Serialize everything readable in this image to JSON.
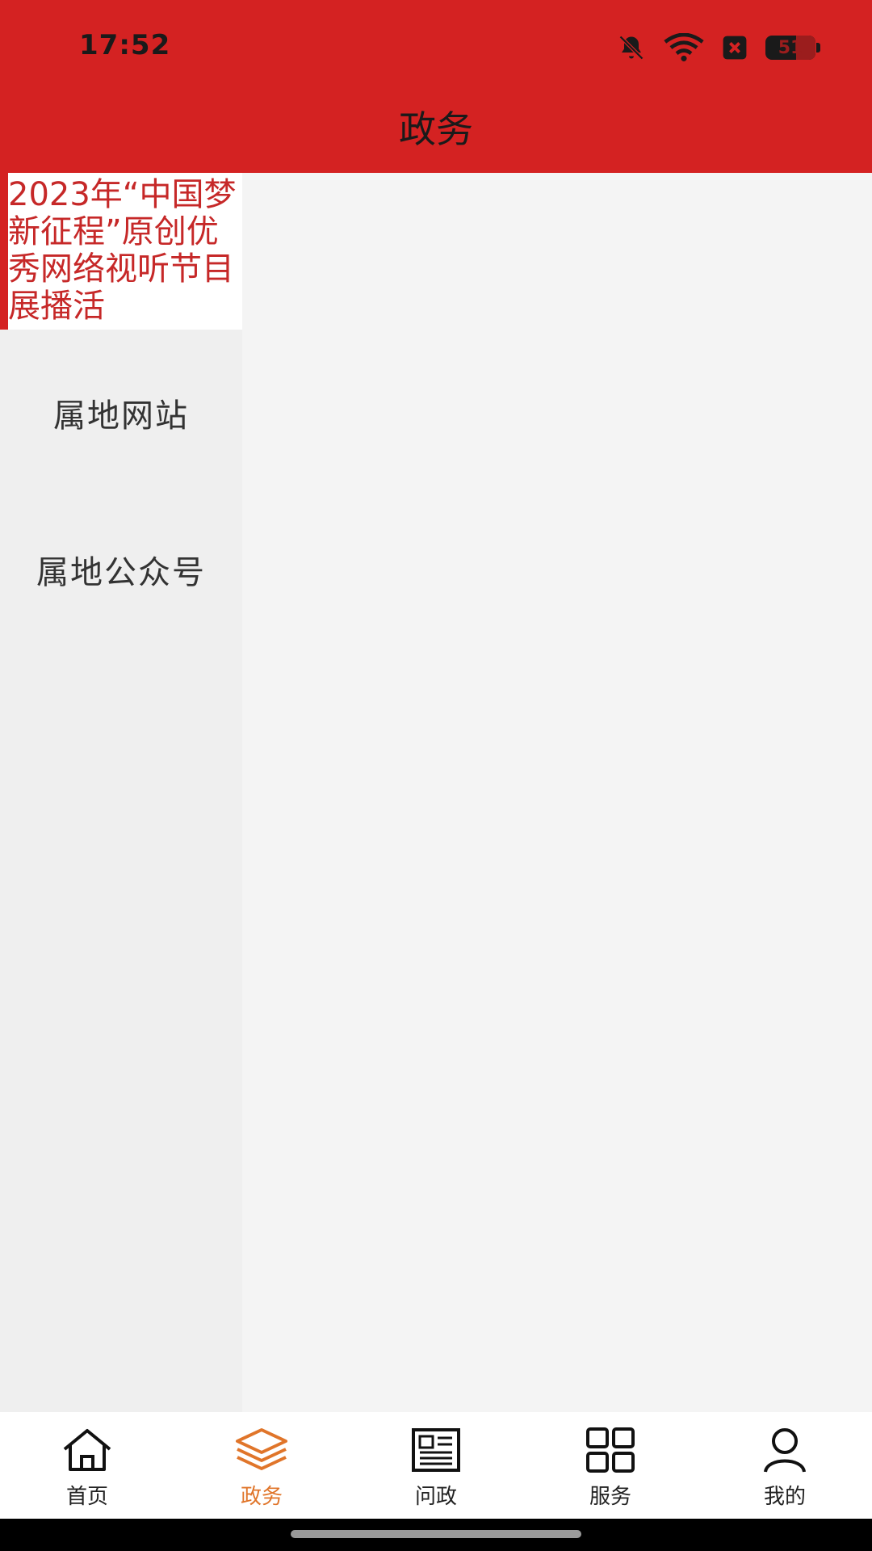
{
  "status_bar": {
    "time": "17:52",
    "battery": "51"
  },
  "header": {
    "title": "政务"
  },
  "sidebar": {
    "items": [
      {
        "label": "2023年“中国梦 新征程”原创优秀网络视听节目展播活",
        "active": true
      },
      {
        "label": "属地网站",
        "active": false
      },
      {
        "label": "属地公众号",
        "active": false
      }
    ]
  },
  "tabbar": {
    "items": [
      {
        "label": "首页",
        "icon": "home-icon",
        "active": false
      },
      {
        "label": "政务",
        "icon": "layers-icon",
        "active": true
      },
      {
        "label": "问政",
        "icon": "newspaper-icon",
        "active": false
      },
      {
        "label": "服务",
        "icon": "grid-icon",
        "active": false
      },
      {
        "label": "我的",
        "icon": "user-icon",
        "active": false
      }
    ]
  },
  "colors": {
    "header": "#d42222",
    "active_tab": "#e0752a",
    "active_sidebar_text": "#c62828"
  }
}
